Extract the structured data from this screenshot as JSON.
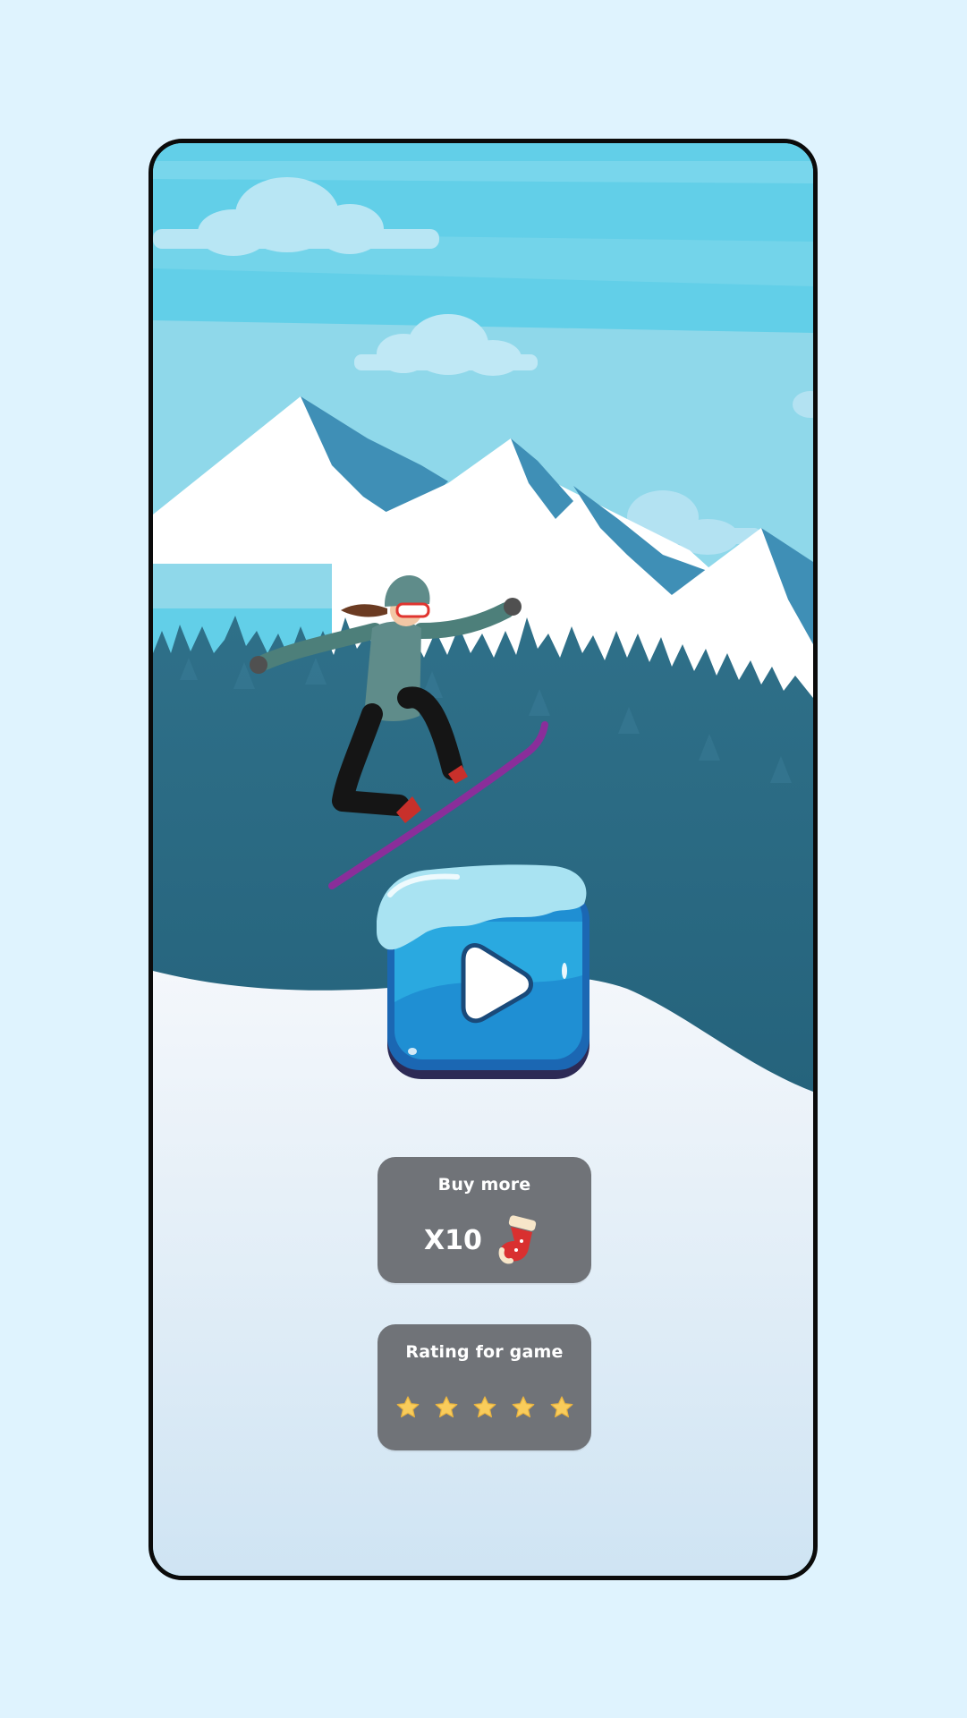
{
  "play": {
    "icon": "play-icon"
  },
  "shop": {
    "title": "Buy more",
    "quantity": "X10",
    "item_icon": "sock-icon"
  },
  "rating": {
    "title": "Rating for game",
    "stars_total": 5,
    "stars_filled": 5,
    "star_color": "#f9cc5b"
  },
  "colors": {
    "page_background": "#dff3fe",
    "sky": "#62cfe8",
    "forest": "#276680",
    "card": "#707378",
    "snowboard": "#8a2e9a",
    "play_button": "#1f8fd3"
  }
}
